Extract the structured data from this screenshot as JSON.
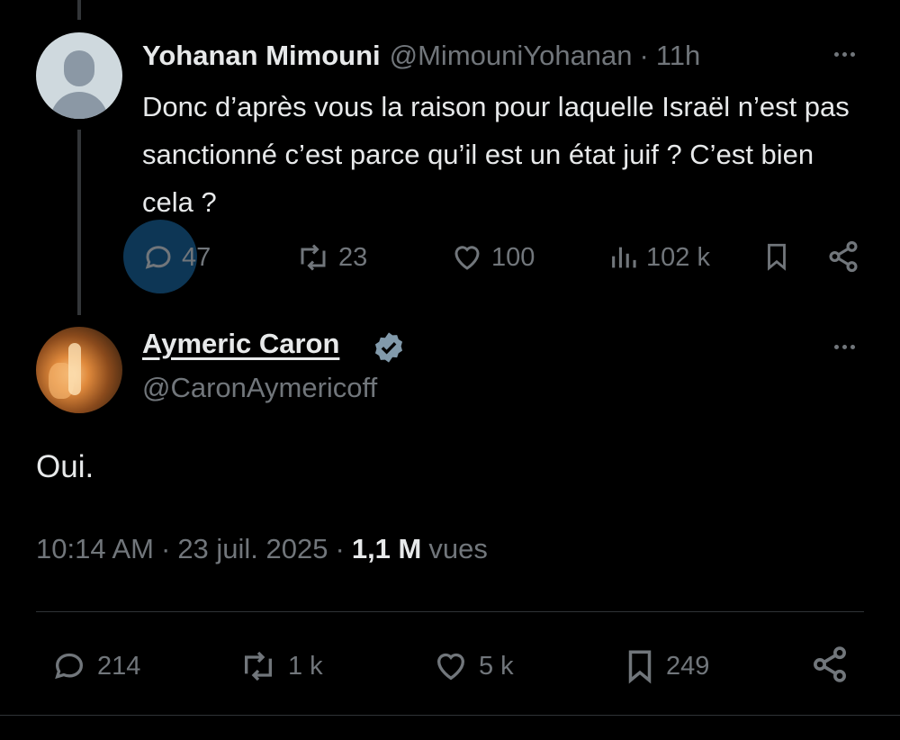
{
  "reply": {
    "author_name": "Yohanan Mimouni",
    "author_handle": "@MimouniYohanan",
    "separator": "·",
    "time": "11h",
    "text": "Donc d’après vous la raison pour laquelle Israël n’est pas sanctionné c’est parce qu’il est un état juif ? C’est bien cela ?",
    "replies": "47",
    "reposts": "23",
    "likes": "100",
    "views": "102 k"
  },
  "tweet": {
    "author_name": "Aymeric Caron",
    "author_handle": "@CaronAymericoff",
    "verified": true,
    "text": "Oui.",
    "time": "10:14 AM",
    "separator": "·",
    "date": "23 juil. 2025",
    "separator2": "·",
    "views_count": "1,1 M",
    "views_label": "vues",
    "replies": "214",
    "reposts": "1 k",
    "likes": "5 k",
    "bookmarks": "249"
  },
  "colors": {
    "background": "#000000",
    "text_primary": "#e7e9ea",
    "text_secondary": "#71767b",
    "accent_highlight": "#0d3655",
    "verified_badge": "#829aab"
  },
  "icons": [
    "more-icon",
    "reply-icon",
    "repost-icon",
    "like-icon",
    "views-icon",
    "bookmark-icon",
    "share-icon",
    "verified-badge-icon"
  ]
}
